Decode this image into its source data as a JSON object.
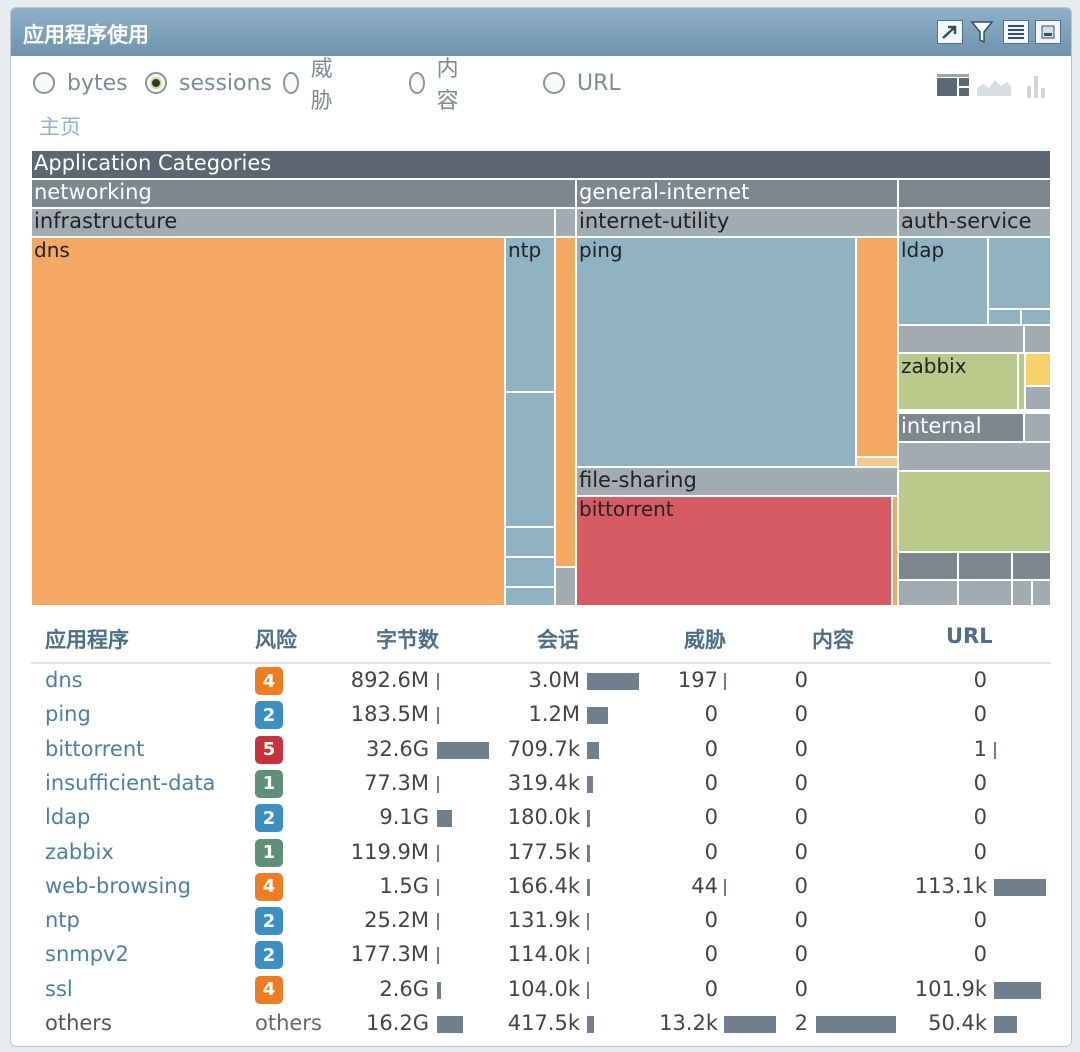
{
  "header": {
    "title": "应用程序使用"
  },
  "radios": [
    {
      "label": "bytes",
      "selected": false
    },
    {
      "label": "sessions",
      "selected": true
    },
    {
      "label": "威胁",
      "selected": false
    },
    {
      "label": "内容",
      "selected": false
    },
    {
      "label": "URL",
      "selected": false
    }
  ],
  "breadcrumb": {
    "home": "主页"
  },
  "treemap": {
    "root_label": "Application Categories",
    "categories": [
      "networking",
      "general-internet"
    ],
    "subcategories": [
      "infrastructure",
      "internet-utility",
      "file-sharing",
      "auth-service",
      "internal"
    ],
    "applications": [
      "dns",
      "ntp",
      "ping",
      "bittorrent",
      "ldap",
      "zabbix"
    ]
  },
  "table": {
    "headers": [
      "应用程序",
      "风险",
      "字节数",
      "会话",
      "威胁",
      "内容",
      "URL"
    ],
    "rows": [
      {
        "app": "dns",
        "risk": "4",
        "bytes": "892.6M",
        "sessions": "3.0M",
        "threats": "197",
        "content": "0",
        "url": "0"
      },
      {
        "app": "ping",
        "risk": "2",
        "bytes": "183.5M",
        "sessions": "1.2M",
        "threats": "0",
        "content": "0",
        "url": "0"
      },
      {
        "app": "bittorrent",
        "risk": "5",
        "bytes": "32.6G",
        "sessions": "709.7k",
        "threats": "0",
        "content": "0",
        "url": "1"
      },
      {
        "app": "insufficient-data",
        "risk": "1",
        "bytes": "77.3M",
        "sessions": "319.4k",
        "threats": "0",
        "content": "0",
        "url": "0"
      },
      {
        "app": "ldap",
        "risk": "2",
        "bytes": "9.1G",
        "sessions": "180.0k",
        "threats": "0",
        "content": "0",
        "url": "0"
      },
      {
        "app": "zabbix",
        "risk": "1",
        "bytes": "119.9M",
        "sessions": "177.5k",
        "threats": "0",
        "content": "0",
        "url": "0"
      },
      {
        "app": "web-browsing",
        "risk": "4",
        "bytes": "1.5G",
        "sessions": "166.4k",
        "threats": "44",
        "content": "0",
        "url": "113.1k"
      },
      {
        "app": "ntp",
        "risk": "2",
        "bytes": "25.2M",
        "sessions": "131.9k",
        "threats": "0",
        "content": "0",
        "url": "0"
      },
      {
        "app": "snmpv2",
        "risk": "2",
        "bytes": "177.3M",
        "sessions": "114.0k",
        "threats": "0",
        "content": "0",
        "url": "0"
      },
      {
        "app": "ssl",
        "risk": "4",
        "bytes": "2.6G",
        "sessions": "104.0k",
        "threats": "0",
        "content": "0",
        "url": "101.9k"
      },
      {
        "app": "others",
        "risk": "others",
        "bytes": "16.2G",
        "sessions": "417.5k",
        "threats": "13.2k",
        "content": "2",
        "url": "50.4k"
      }
    ]
  },
  "colors": {
    "risk_1": "#5e8f7a",
    "risk_2": "#3c8fc2",
    "risk_4": "#ee7d22",
    "risk_5": "#c8323c",
    "header_bg": "#7a9bb4",
    "bar": "#6f7f8b"
  }
}
